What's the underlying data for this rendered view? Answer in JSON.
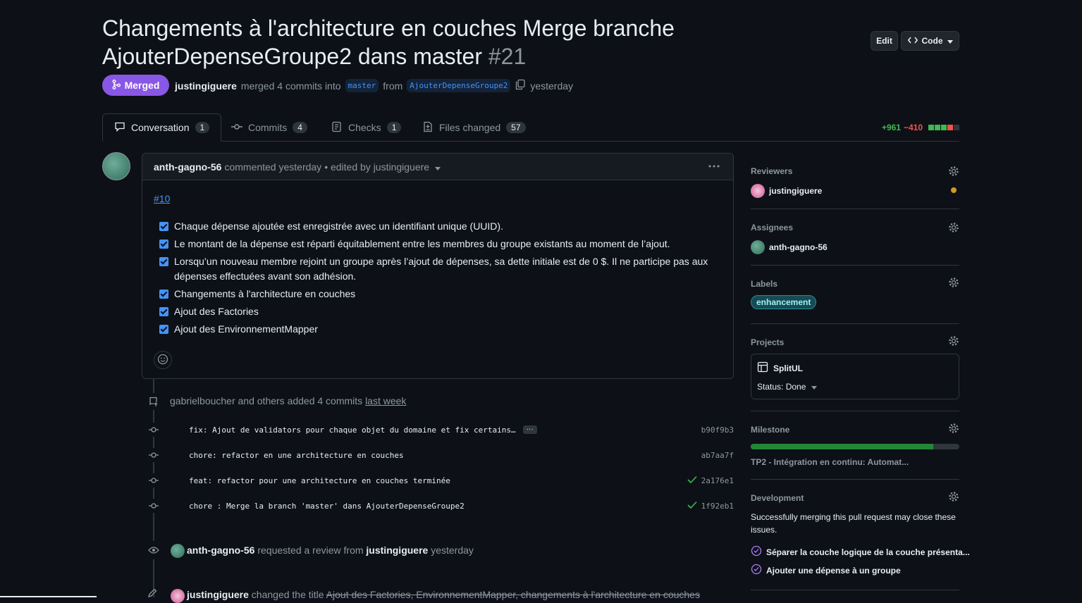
{
  "header": {
    "title": "Changements à l'architecture en couches Merge branche AjouterDepenseGroupe2 dans master",
    "number": "#21",
    "edit_label": "Edit",
    "code_label": "Code",
    "state": "Merged",
    "author": "justingiguere",
    "merged_text": "merged 4 commits into",
    "base_branch": "master",
    "from_text": "from",
    "head_branch": "AjouterDepenseGroupe2",
    "time": "yesterday"
  },
  "tabs": [
    {
      "label": "Conversation",
      "count": "1",
      "icon": "comment-icon"
    },
    {
      "label": "Commits",
      "count": "4",
      "icon": "commit-icon"
    },
    {
      "label": "Checks",
      "count": "1",
      "icon": "checklist-icon"
    },
    {
      "label": "Files changed",
      "count": "57",
      "icon": "file-diff-icon"
    }
  ],
  "diffstat": {
    "additions": "+961",
    "deletions": "−410"
  },
  "comment": {
    "author": "anth-gagno-56",
    "action": "commented yesterday",
    "edited": "• edited by justingiguere",
    "issue_link": "#10",
    "tasks": [
      "Chaque dépense ajoutée est enregistrée avec un identifiant unique (UUID).",
      "Le montant de la dépense est réparti équitablement entre les membres du groupe existants au moment de l’ajout.",
      "Lorsqu’un nouveau membre rejoint un groupe après l’ajout de dépenses, sa dette initiale est de 0 $. Il ne participe pas aux dépenses effectuées avant son adhésion.",
      "Changements à l'architecture en couches",
      "Ajout des Factories",
      "Ajout des EnvironnementMapper"
    ]
  },
  "timeline": {
    "commits_author": "gabrielboucher",
    "commits_text": "and others added 4 commits",
    "commits_time": "last week",
    "commits": [
      {
        "message": "fix: Ajout de validators pour chaque objet du domaine et fix certains…",
        "sha": "b90f9b3",
        "check": false,
        "more": true
      },
      {
        "message": "chore: refactor en une architecture en couches",
        "sha": "ab7aa7f",
        "check": false,
        "more": false
      },
      {
        "message": "feat: refactor pour une architecture en couches terminée",
        "sha": "2a176e1",
        "check": true,
        "more": false
      },
      {
        "message": "chore : Merge la branch 'master' dans AjouterDepenseGroupe2",
        "sha": "1f92eb1",
        "check": true,
        "more": false
      }
    ],
    "review_actor": "anth-gagno-56",
    "review_text": "requested a review from",
    "review_target": "justingiguere",
    "review_time": "yesterday",
    "rename_actor": "justingiguere",
    "rename_text": "changed the title",
    "rename_old": "Ajout des Factories, EnvironnementMapper, changements à l'architecture en couches"
  },
  "sidebar": {
    "reviewers_label": "Reviewers",
    "reviewer": "justingiguere",
    "assignees_label": "Assignees",
    "assignee": "anth-gagno-56",
    "labels_label": "Labels",
    "label": "enhancement",
    "projects_label": "Projects",
    "project_name": "SplitUL",
    "project_status": "Status: Done",
    "milestone_label": "Milestone",
    "milestone_progress": 0.875,
    "milestone_name": "TP2 - Intégration en continu: Automat...",
    "development_label": "Development",
    "development_text": "Successfully merging this pull request may close these issues.",
    "issues": [
      "Séparer la couche logique de la couche présenta...",
      "Ajouter une dépense à un groupe"
    ]
  },
  "colors": {
    "merged": "#8957e5",
    "link": "#4493f8",
    "success": "#3fb950",
    "danger": "#f85149",
    "pending": "#d29922"
  }
}
